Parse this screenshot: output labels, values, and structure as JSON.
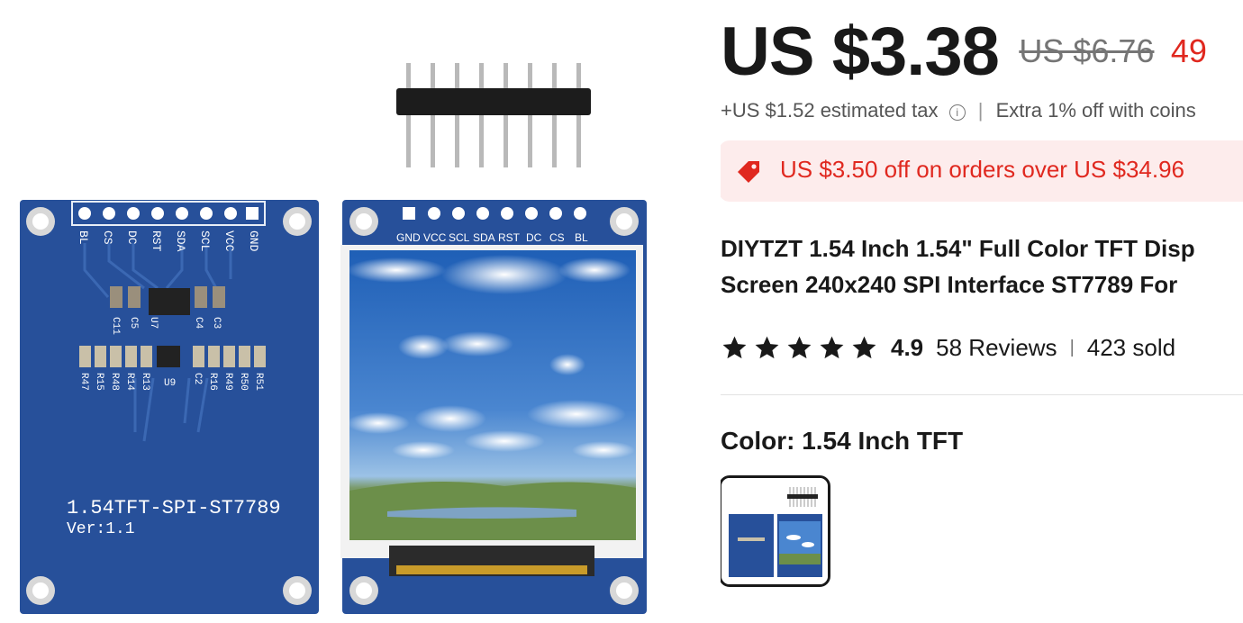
{
  "price": {
    "current": "US $3.38",
    "original": "US $6.76",
    "discount": "49",
    "tax_note": "+US $1.52 estimated tax",
    "coins_note": "Extra 1% off with coins"
  },
  "coupon": {
    "text": "US $3.50 off on orders over US $34.96",
    "icon": "tag-icon",
    "color": "#e0281f"
  },
  "product": {
    "title_line1": "DIYTZT 1.54 Inch 1.54\" Full Color TFT Disp",
    "title_line2": "Screen 240x240 SPI Interface ST7789 For"
  },
  "rating": {
    "score": "4.9",
    "stars_filled": 5,
    "reviews": "58 Reviews",
    "sold": "423 sold"
  },
  "variant": {
    "label": "Color: 1.54 Inch TFT",
    "selected_index": 0
  },
  "board": {
    "back_pins": [
      "BL",
      "CS",
      "DC",
      "RST",
      "SDA",
      "SCL",
      "VCC",
      "GND"
    ],
    "front_pins": [
      "GND",
      "VCC",
      "SCL",
      "SDA",
      "RST",
      "DC",
      "CS",
      "BL"
    ],
    "silk_line1": "1.54TFT-SPI-ST7789",
    "silk_line2": "Ver:1.1",
    "components_top": [
      "C11",
      "C5",
      "U7",
      "C4",
      "C3"
    ],
    "components_bottom": [
      "R47",
      "R15",
      "R48",
      "R14",
      "R13",
      "U9",
      "C2",
      "R16",
      "R49",
      "R50",
      "R51"
    ]
  },
  "colors": {
    "pcb": "#27509a",
    "accent": "#e0281f",
    "text": "#191919"
  }
}
